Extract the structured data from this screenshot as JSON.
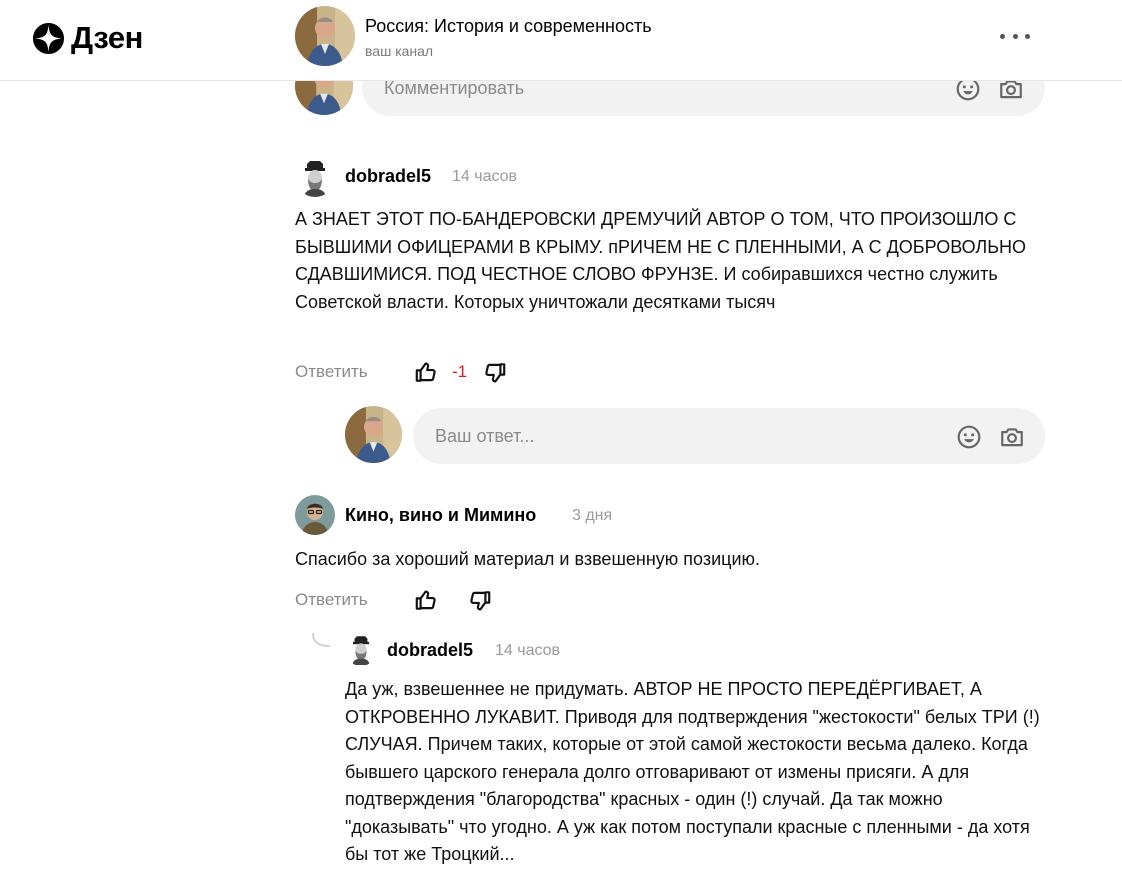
{
  "logo": {
    "brand": "Дзен"
  },
  "header": {
    "channel_title": "Россия: История и современность",
    "channel_subtitle": "ваш канал"
  },
  "top_input": {
    "placeholder": "Комментировать"
  },
  "comments": [
    {
      "user": "dobradel5",
      "time": "14 часов",
      "text": "А ЗНАЕТ ЭТОТ ПО-БАНДЕРОВСКИ ДРЕМУЧИЙ АВТОР О ТОМ, ЧТО ПРОИЗОШЛО С БЫВШИМИ ОФИЦЕРАМИ В КРЫМУ. пРИЧЕМ НЕ С ПЛЕННЫМИ, А С ДОБРОВОЛЬНО СДАВШИМИСЯ. ПОД ЧЕСТНОЕ СЛОВО ФРУНЗЕ. И собиравшихся честно служить Советской власти. Которых уничтожали десятками тысяч",
      "reply_label": "Ответить",
      "score": "-1"
    },
    {
      "user": "Кино, вино и Мимино",
      "time": "3 дня",
      "text": "Спасибо за хороший материал и взвешенную позицию.",
      "reply_label": "Ответить"
    }
  ],
  "reply_input": {
    "placeholder": "Ваш ответ..."
  },
  "nested_reply": {
    "user": "dobradel5",
    "time": "14 часов",
    "text": "Да уж, взвешеннее не придумать. АВТОР НЕ ПРОСТО ПЕРЕДЁРГИВАЕТ, А ОТКРОВЕННО ЛУКАВИТ. Приводя для подтверждения \"жестокости\" белых ТРИ (!) СЛУЧАЯ. Причем таких, которые от этой самой жестокости весьма далеко. Когда бывшего царского генерала долго отговаривают от измены присяги. А для подтверждения \"благородства\" красных - один (!) случай. Да так можно \"доказывать\" что угодно. А уж как потом поступали красные с пленными - да хотя бы тот же Троцкий..."
  },
  "colors": {
    "negative_score": "#d81e1e",
    "input_bg": "#f2f2f2",
    "muted": "#8a8a8a"
  }
}
